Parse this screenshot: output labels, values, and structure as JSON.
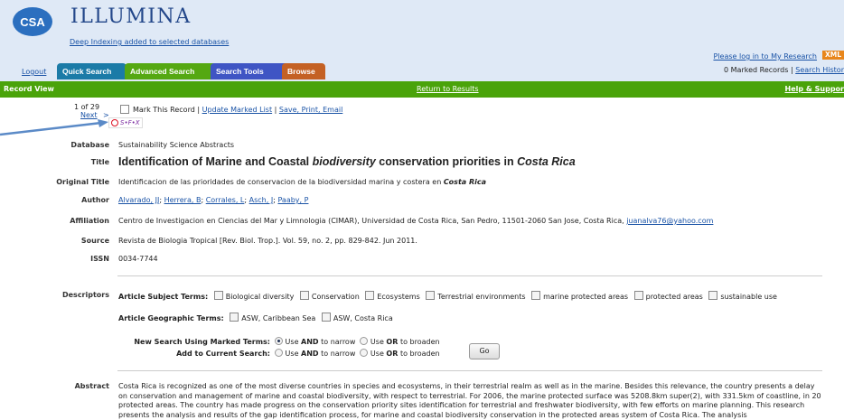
{
  "header": {
    "logo_text": "CSA",
    "brand": "ILLUMINA",
    "deep_indexing_link": "Deep Indexing added to selected databases",
    "logout": "Logout",
    "tabs": [
      "Quick Search",
      "Advanced Search",
      "Search Tools",
      "Browse"
    ],
    "login_link": "Please log in to My Research",
    "xml_badge": "XML",
    "marked_records": "0 Marked Records",
    "separator": "|",
    "search_history": "Search Histor"
  },
  "greenbar": {
    "title": "Record View",
    "return_link": "Return to Results",
    "help_link": "Help & Suppor"
  },
  "record_nav": {
    "count": "1 of 29",
    "next": "Next",
    "next_arrow": ">",
    "mark_label": "Mark This Record",
    "update_link": "Update Marked List",
    "save_link": "Save, Print, Email",
    "sfx_label": "S•F•X",
    "sep": "|"
  },
  "fields": {
    "database_label": "Database",
    "database": "Sustainability Science Abstracts",
    "title_label": "Title",
    "title_parts": [
      "Identification of Marine and Coastal ",
      "biodiversity",
      " conservation priorities in ",
      "Costa Rica"
    ],
    "original_title_label": "Original Title",
    "original_title_main": "Identificacion de las prioridades de conservacion de la biodiversidad marina y costera en ",
    "original_title_em": "Costa Rica",
    "author_label": "Author",
    "authors": [
      "Alvarado, JJ",
      "Herrera, B",
      "Corrales, L",
      "Asch, J",
      "Paaby, P"
    ],
    "affiliation_label": "Affiliation",
    "affiliation": "Centro de Investigacion en Ciencias del Mar y Limnologia (CIMAR), Universidad de Costa Rica, San Pedro, 11501-2060 San Jose, Costa Rica, ",
    "affiliation_email": "juanalva76@yahoo.com",
    "source_label": "Source",
    "source": "Revista de Biologia Tropical [Rev. Biol. Trop.]. Vol. 59, no. 2, pp. 829-842. Jun 2011.",
    "issn_label": "ISSN",
    "issn": "0034-7744"
  },
  "descriptors": {
    "label": "Descriptors",
    "subject_label": "Article Subject Terms:",
    "subject_terms": [
      "Biological diversity",
      "Conservation",
      "Ecosystems",
      "Terrestrial environments",
      "marine protected areas",
      "protected areas",
      "sustainable use"
    ],
    "geo_label": "Article Geographic Terms:",
    "geo_terms": [
      "ASW, Caribbean Sea",
      "ASW, Costa Rica"
    ],
    "new_search_label": "New Search Using Marked Terms:",
    "add_search_label": "Add to Current Search:",
    "use": "Use",
    "and_word": "AND",
    "or_word": "OR",
    "to_narrow": "to narrow",
    "to_broaden": "to broaden",
    "go_button": "Go"
  },
  "abstract": {
    "label": "Abstract",
    "text": "Costa Rica is recognized as one of the most diverse countries in species and ecosystems, in their terrestrial realm as well as in the marine. Besides this relevance, the country presents a delay on conservation and management of marine and coastal biodiversity, with respect to terrestrial. For 2006, the marine protected surface was 5208.8km super(2), with 331.5km of coastline, in 20 protected areas. The country has made progress on the conservation priority sites identification for terrestrial and freshwater biodiversity, with few efforts on marine planning. This research presents the analysis and results of the gap identification process, for marine and coastal biodiversity conservation in the protected areas system of Costa Rica. The analysis"
  }
}
